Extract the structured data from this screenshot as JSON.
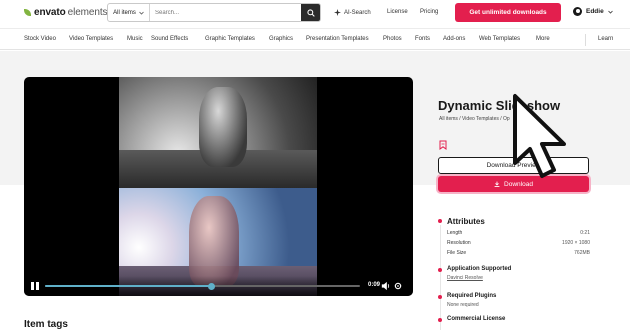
{
  "header": {
    "logo_main": "envato",
    "logo_sub": "elements",
    "search_category": "All items",
    "search_placeholder": "Search...",
    "ai_search": "AI-Search",
    "license": "License",
    "pricing": "Pricing",
    "cta": "Get unlimited downloads",
    "user_name": "Eddie"
  },
  "categories": [
    "Stock Video",
    "Video Templates",
    "Music",
    "Sound Effects",
    "Graphic Templates",
    "Graphics",
    "Presentation Templates",
    "Photos",
    "Fonts",
    "Add-ons",
    "Web Templates",
    "More",
    "Learn"
  ],
  "player": {
    "time": "0:09",
    "progress": 0.53
  },
  "item": {
    "title": "Dynamic Slideshow",
    "breadcrumb": "All items / Video Templates / Op",
    "preview_button": "Download Preview",
    "download_button": "Download"
  },
  "attributes": {
    "heading": "Attributes",
    "rows": [
      {
        "label": "Length",
        "value": "0:21"
      },
      {
        "label": "Resolution",
        "value": "1920 × 1080"
      },
      {
        "label": "File Size",
        "value": "762MB"
      }
    ],
    "app_heading": "Application Supported",
    "app_value": "Davinci Resolve",
    "plugins_heading": "Required Plugins",
    "plugins_value": "None required",
    "commercial_heading": "Commercial License"
  },
  "item_tags": "Item tags",
  "colors": {
    "accent": "#e31f4e",
    "logo_green": "#82b440",
    "progress": "#5fb0c9"
  }
}
